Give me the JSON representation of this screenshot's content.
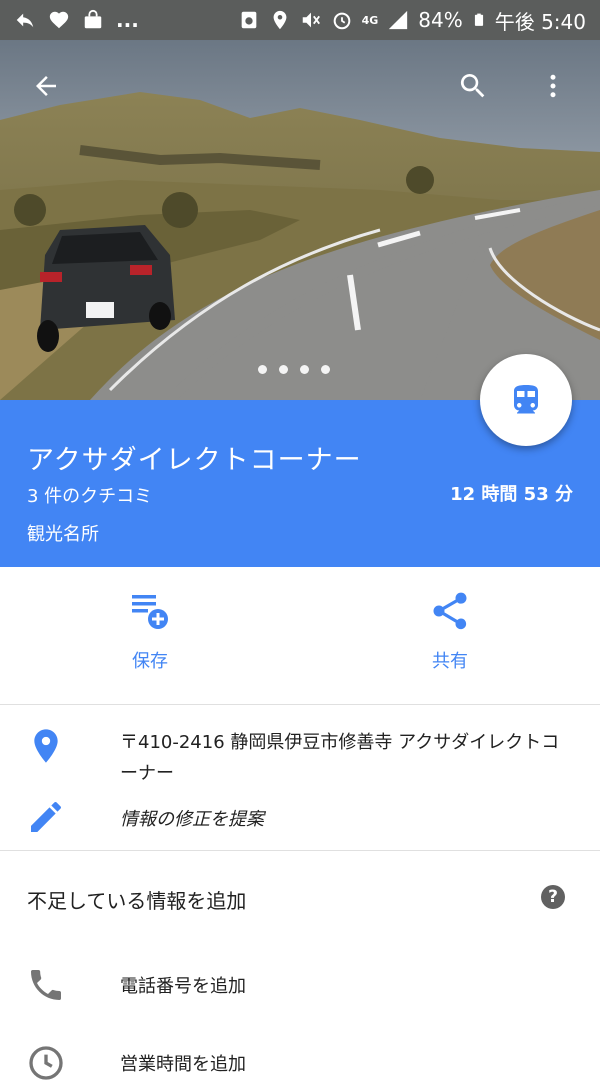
{
  "status_bar": {
    "battery": "84%",
    "time": "午後 5:40",
    "network": "4G",
    "more": "..."
  },
  "hero": {
    "photo_index": 1,
    "photo_count": 4
  },
  "place": {
    "name": "アクサダイレクトコーナー",
    "reviews": "3 件のクチコミ",
    "category": "観光名所",
    "duration": "12 時間 53 分"
  },
  "actions": {
    "save_label": "保存",
    "share_label": "共有"
  },
  "details": {
    "address": "〒410-2416 静岡県伊豆市修善寺 アクサダイレクトコーナー",
    "suggest_edit": "情報の修正を提案",
    "missing_info": "不足している情報を追加",
    "add_phone": "電話番号を追加",
    "add_hours": "営業時間を追加"
  },
  "colors": {
    "accent": "#4285f4",
    "status_bar": "#5b5d5c"
  }
}
